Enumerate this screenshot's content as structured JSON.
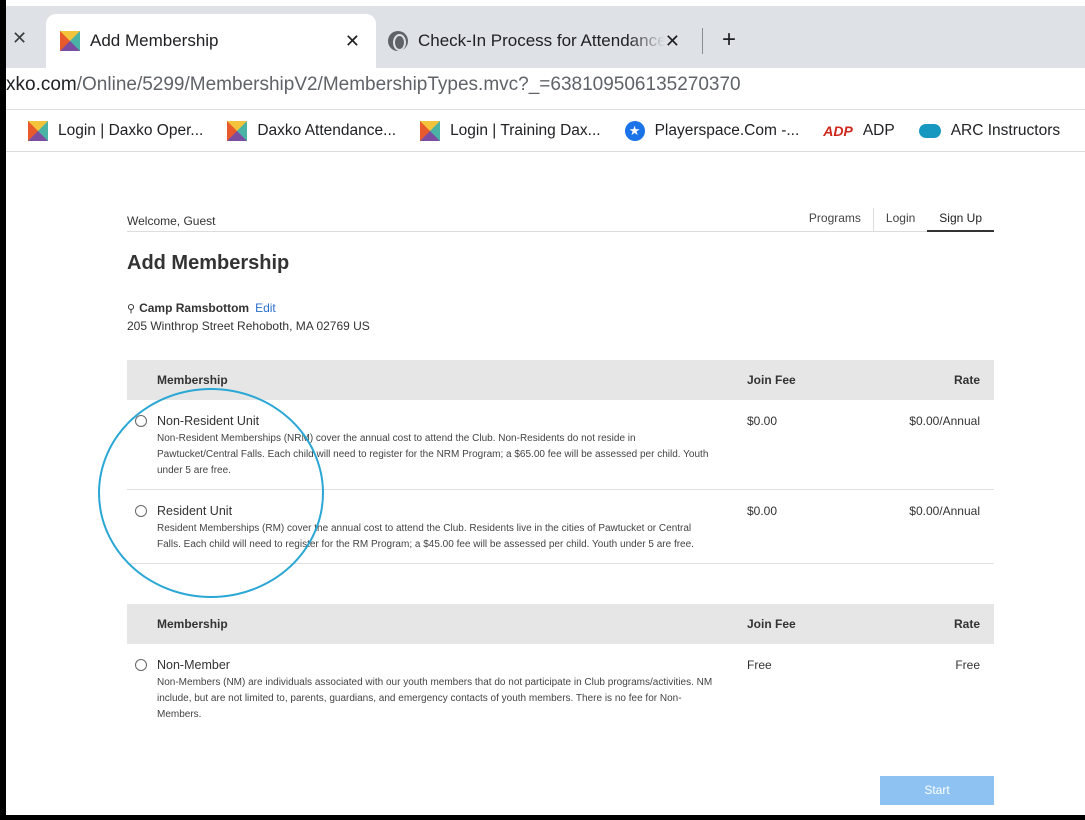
{
  "browser": {
    "tabs": [
      {
        "title": "Add Membership",
        "icon": "daxko-icon",
        "active": true
      },
      {
        "title": "Check-In Process for Attendance",
        "icon": "globe-icon",
        "active": false
      }
    ],
    "url_prefix": "xko.com",
    "url_path": "/Online/5299/MembershipV2/MembershipTypes.mvc?_=638109506135270370",
    "bookmarks": [
      {
        "label": "Login | Daxko Oper...",
        "icon": "daxko-icon"
      },
      {
        "label": "Daxko Attendance...",
        "icon": "daxko-icon"
      },
      {
        "label": "Login | Training Dax...",
        "icon": "daxko-icon"
      },
      {
        "label": "Playerspace.Com -...",
        "icon": "star-icon"
      },
      {
        "label": "ADP",
        "icon": "adp-icon"
      },
      {
        "label": "ARC Instructors",
        "icon": "cloud-icon"
      }
    ]
  },
  "nav": {
    "welcome": "Welcome, Guest",
    "programs": "Programs",
    "login": "Login",
    "signup": "Sign Up"
  },
  "page": {
    "title": "Add Membership",
    "location_name": "Camp Ramsbottom",
    "edit": "Edit",
    "address": "205 Winthrop Street Rehoboth, MA 02769 US"
  },
  "table1": {
    "headers": {
      "membership": "Membership",
      "join_fee": "Join Fee",
      "rate": "Rate"
    },
    "rows": [
      {
        "name": "Non-Resident Unit",
        "desc": "Non-Resident Memberships (NRM) cover the annual cost to attend the Club. Non-Residents do not reside in Pawtucket/Central Falls. Each child will need to register for the NRM Program; a $65.00 fee will be assessed per child. Youth under 5 are free.",
        "join_fee": "$0.00",
        "rate": "$0.00/Annual"
      },
      {
        "name": "Resident Unit",
        "desc": "Resident Memberships (RM) cover the annual cost to attend the Club. Residents live in the cities of Pawtucket or Central Falls. Each child will need to register for the RM Program; a $45.00 fee will be assessed per child. Youth under 5 are free.",
        "join_fee": "$0.00",
        "rate": "$0.00/Annual"
      }
    ]
  },
  "table2": {
    "headers": {
      "membership": "Membership",
      "join_fee": "Join Fee",
      "rate": "Rate"
    },
    "rows": [
      {
        "name": "Non-Member",
        "desc": "Non-Members (NM) are individuals associated with our youth members that do not participate in Club programs/activities. NM include, but are not limited to, parents, guardians, and emergency contacts of youth members. There is no fee for Non-Members.",
        "join_fee": "Free",
        "rate": "Free"
      }
    ]
  },
  "start_label": "Start",
  "colors": {
    "accent": "#2a6fcf",
    "start_button": "#8ec2f2",
    "annotation_circle": "#2aa7d4"
  }
}
